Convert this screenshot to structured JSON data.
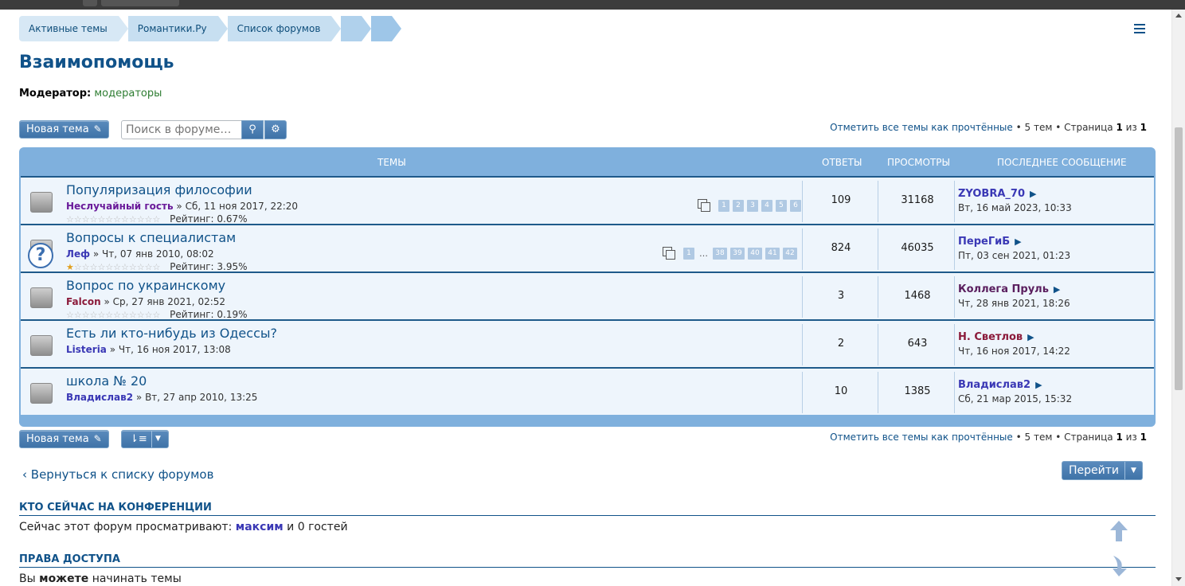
{
  "breadcrumbs": [
    "Активные темы",
    "Романтики.Ру",
    "Список форумов"
  ],
  "page_title": "Взаимопомощь",
  "moderator": {
    "label": "Модератор:",
    "value": "модераторы"
  },
  "toolbar": {
    "new_topic": "Новая тема",
    "search_placeholder": "Поиск в форуме…"
  },
  "pagination": {
    "mark_read": "Отметить все темы как прочтённые",
    "topics_count": "5 тем",
    "page_label": "Страница",
    "page_current": "1",
    "page_of": "из",
    "page_total": "1"
  },
  "table_headers": {
    "topics": "ТЕМЫ",
    "replies": "ОТВЕТЫ",
    "views": "ПРОСМОТРЫ",
    "last_post": "ПОСЛЕДНЕЕ СООБЩЕНИЕ"
  },
  "topics": [
    {
      "title": "Популяризация философии",
      "author": "Неслучайный гость",
      "author_color": "#6a1b9a",
      "date": "Сб, 11 ноя 2017, 22:20",
      "rating": "Рейтинг: 0.67%",
      "pages": [
        "1",
        "2",
        "3",
        "4",
        "5",
        "6"
      ],
      "replies": "109",
      "views": "31168",
      "last_author": "ZYOBRA_70",
      "last_author_color": "#3a38b5",
      "last_date": "Вт, 16 май 2023, 10:33"
    },
    {
      "title": "Вопросы к специалистам",
      "author": "Леф",
      "author_color": "#3a38b5",
      "date": "Чт, 07 янв 2010, 08:02",
      "rating": "Рейтинг: 3.95%",
      "pages": [
        "1",
        "…",
        "38",
        "39",
        "40",
        "41",
        "42"
      ],
      "replies": "824",
      "views": "46035",
      "last_author": "ПереГиБ",
      "last_author_color": "#3a38b5",
      "last_date": "Пт, 03 сен 2021, 01:23"
    },
    {
      "title": "Вопрос по украинскому",
      "author": "Falcon",
      "author_color": "#8b1a3a",
      "date": "Ср, 27 янв 2021, 02:52",
      "rating": "Рейтинг: 0.19%",
      "replies": "3",
      "views": "1468",
      "last_author": "Коллега Пруль",
      "last_author_color": "#5a1e5e",
      "last_date": "Чт, 28 янв 2021, 18:26"
    },
    {
      "title": "Есть ли кто-нибудь из Одессы?",
      "author": "Listeria",
      "author_color": "#3a38b5",
      "date": "Чт, 16 ноя 2017, 13:08",
      "replies": "2",
      "views": "643",
      "last_author": "Н. Светлов",
      "last_author_color": "#8b1a3a",
      "last_date": "Чт, 16 ноя 2017, 14:22"
    },
    {
      "title": "школа № 20",
      "author": "Владислав2",
      "author_color": "#3a38b5",
      "date": "Вт, 27 апр 2010, 13:25",
      "replies": "10",
      "views": "1385",
      "last_author": "Владислав2",
      "last_author_color": "#3a38b5",
      "last_date": "Сб, 21 мар 2015, 15:32"
    }
  ],
  "meta_separator": "»",
  "back_link": "Вернуться к списку форумов",
  "jump_button": "Перейти",
  "who_online": {
    "heading": "КТО СЕЙЧАС НА КОНФЕРЕНЦИИ",
    "text_prefix": "Сейчас этот форум просматривают:",
    "user": "максим",
    "text_suffix": "и 0 гостей"
  },
  "permissions": {
    "heading": "ПРАВА ДОСТУПА",
    "text_prefix": "Вы",
    "text_bold": "можете",
    "text_suffix": "начинать темы"
  },
  "colors": {
    "header_blue": "#7fb0dd",
    "link_blue": "#105289",
    "row_bg": "#eef5fc"
  }
}
